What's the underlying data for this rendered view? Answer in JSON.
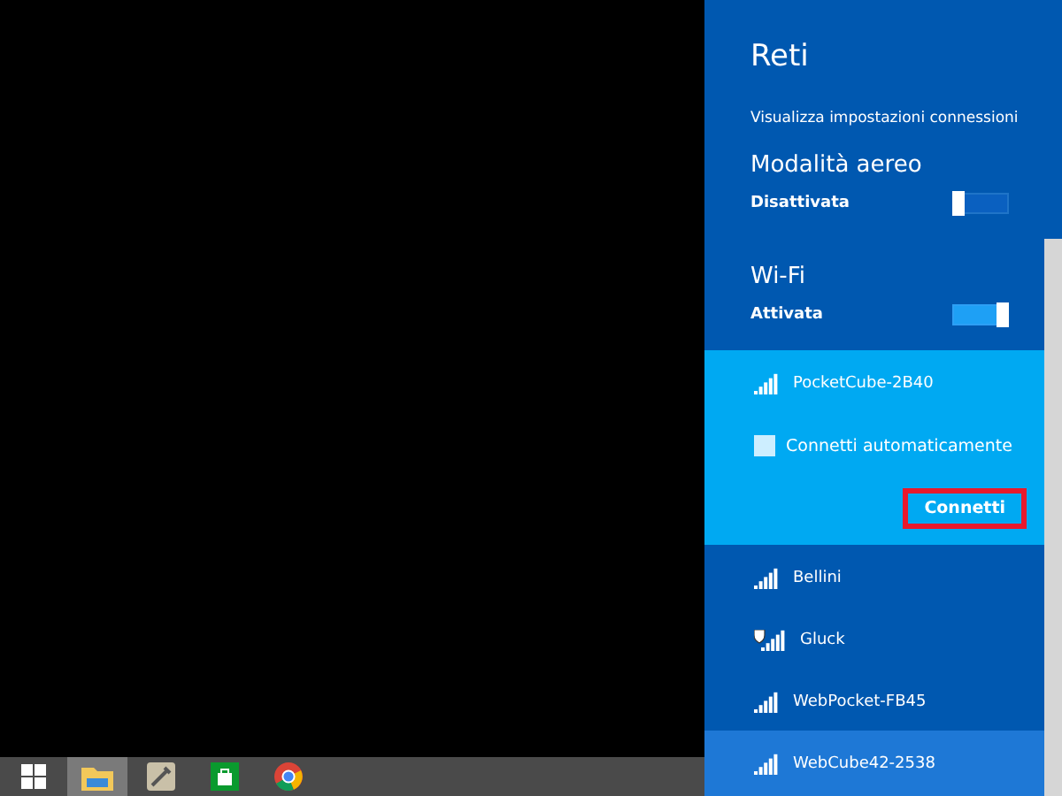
{
  "panel": {
    "title": "Reti",
    "settings_link": "Visualizza impostazioni connessioni",
    "airplane": {
      "label": "Modalità aereo",
      "state_text": "Disattivata",
      "on": false
    },
    "wifi": {
      "label": "Wi-Fi",
      "state_text": "Attivata",
      "on": true
    },
    "networks": [
      {
        "name": "PocketCube-2B40",
        "secured": false,
        "selected": true,
        "highlighted": false,
        "auto_connect": {
          "label": "Connetti automaticamente",
          "checked": false
        },
        "connect_button": "Connetti"
      },
      {
        "name": "Bellini",
        "secured": false,
        "selected": false,
        "highlighted": false
      },
      {
        "name": "Gluck",
        "secured": true,
        "selected": false,
        "highlighted": false
      },
      {
        "name": "WebPocket-FB45",
        "secured": false,
        "selected": false,
        "highlighted": false
      },
      {
        "name": "WebCube42-2538",
        "secured": false,
        "selected": false,
        "highlighted": true
      }
    ]
  },
  "taskbar": {
    "apps": [
      {
        "kind": "start",
        "selected": false
      },
      {
        "kind": "explorer",
        "selected": true
      },
      {
        "kind": "tool",
        "selected": false
      },
      {
        "kind": "store",
        "selected": false
      },
      {
        "kind": "browser",
        "selected": false
      }
    ]
  }
}
